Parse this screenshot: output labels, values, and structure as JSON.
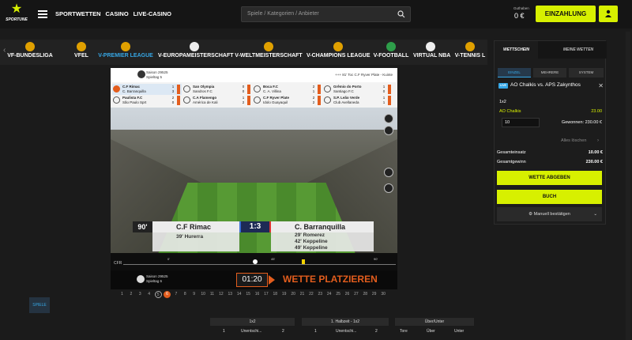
{
  "app": {
    "logo_text": "SPORTUNE",
    "nav": [
      "SPORTWETTEN",
      "CASINO",
      "LIVE-CASINO"
    ],
    "search_placeholder": "Spiele / Kategorien / Anbieter",
    "balance_label": "Guthaben",
    "balance_value": "0 €",
    "deposit_label": "EINZAHLUNG"
  },
  "leagues": [
    {
      "label": "VF-BUNDESLIGA",
      "active": false
    },
    {
      "label": "VFEL",
      "active": false
    },
    {
      "label": "V-PREMIER LEAGUE",
      "active": true
    },
    {
      "label": "V-EUROPAMEISTERSCHAFT",
      "active": false
    },
    {
      "label": "V-WELTMEISTERSCHAFT",
      "active": false
    },
    {
      "label": "V-CHAMPIONS LEAGUE",
      "active": false
    },
    {
      "label": "V-FOOTBALL",
      "active": false
    },
    {
      "label": "VIRTUAL NBA",
      "active": false
    },
    {
      "label": "V-TENNIS L",
      "active": false
    }
  ],
  "player": {
    "season": "Saison 29525",
    "matchday": "Spieltag 5",
    "ticker": "+++ 81' Toc C.F Ryver Plate - Kuinte",
    "matches": [
      {
        "home": "C.F Rimac",
        "away": "C. Barranquilla",
        "hs": "1",
        "as": "3",
        "live": true
      },
      {
        "home": "Paulista F.C",
        "away": "São Paulo Sprt",
        "hs": "2",
        "as": "0",
        "live": false
      },
      {
        "home": "San Olympia",
        "away": "Sandros F.C",
        "hs": "0",
        "as": "0",
        "live": false
      },
      {
        "home": "C.A Flamengo",
        "away": "América de Kali",
        "hs": "1",
        "as": "2",
        "live": false
      },
      {
        "home": "Boca F.C",
        "away": "C. A. Villina",
        "hs": "2",
        "as": "1",
        "live": false
      },
      {
        "home": "C.F Ryver Plate",
        "away": "Idolo Guayaquil",
        "hs": "2",
        "as": "2",
        "live": false
      },
      {
        "home": "Grêmio do Porto",
        "away": "Santiago F.C",
        "hs": "1",
        "as": "0",
        "live": false
      },
      {
        "home": "S.P. Leão Verde",
        "away": "Club Avellaneda",
        "hs": "1",
        "as": "1",
        "live": false
      }
    ],
    "scoreboard": {
      "minute": "90'",
      "home": "C.F Rimac",
      "away": "C. Barranquilla",
      "score": "1:3",
      "home_goals": [
        "39'  Hurerra"
      ],
      "away_goals": [
        "29'  Romerez",
        "42'  Keppeline",
        "49'  Keppeline"
      ]
    },
    "timeline": {
      "label": "CFR",
      "marks": [
        "0'",
        "45'",
        "90'"
      ]
    },
    "next": {
      "season": "Saison 29525",
      "matchday": "Spieltag 6",
      "timer": "01:20",
      "cta": "WETTE PLATZIEREN"
    },
    "days": [
      "1",
      "2",
      "3",
      "4",
      "5",
      "6",
      "7",
      "8",
      "9",
      "10",
      "11",
      "12",
      "13",
      "14",
      "15",
      "16",
      "17",
      "18",
      "19",
      "20",
      "21",
      "22",
      "23",
      "24",
      "25",
      "26",
      "27",
      "28",
      "29",
      "30"
    ]
  },
  "markets": {
    "tab": "SPIELE",
    "heads": [
      "1x2",
      "1. Halbzeit - 1x2",
      "Über/Unter"
    ],
    "cells": [
      "1",
      "Unentschi...",
      "2",
      "1",
      "Unentschi...",
      "2",
      "Tore",
      "Über",
      "Unter"
    ]
  },
  "betslip": {
    "tabs": [
      "WETTSCHEIN",
      "MEINE WETTEN"
    ],
    "modes": [
      "EINZEL",
      "MEHRERE",
      "SYSTEM"
    ],
    "live_tag": "LIVE",
    "match": "AO Chalkis vs. APS Zakynthos",
    "market": "1x2",
    "selection": "AO Chalkis",
    "odds": "23.00",
    "stake": "10",
    "win_text": "Gewonnen: 230.00 €",
    "clear_all": "Alles löschen",
    "total_stake_label": "Gesamteinsatz",
    "total_stake": "10.00 €",
    "total_win_label": "Gesamtgewinn",
    "total_win": "230.00 €",
    "place_bet": "WETTE ABGEBEN",
    "book": "BUCH",
    "manual": "Manuell bestätigen"
  }
}
